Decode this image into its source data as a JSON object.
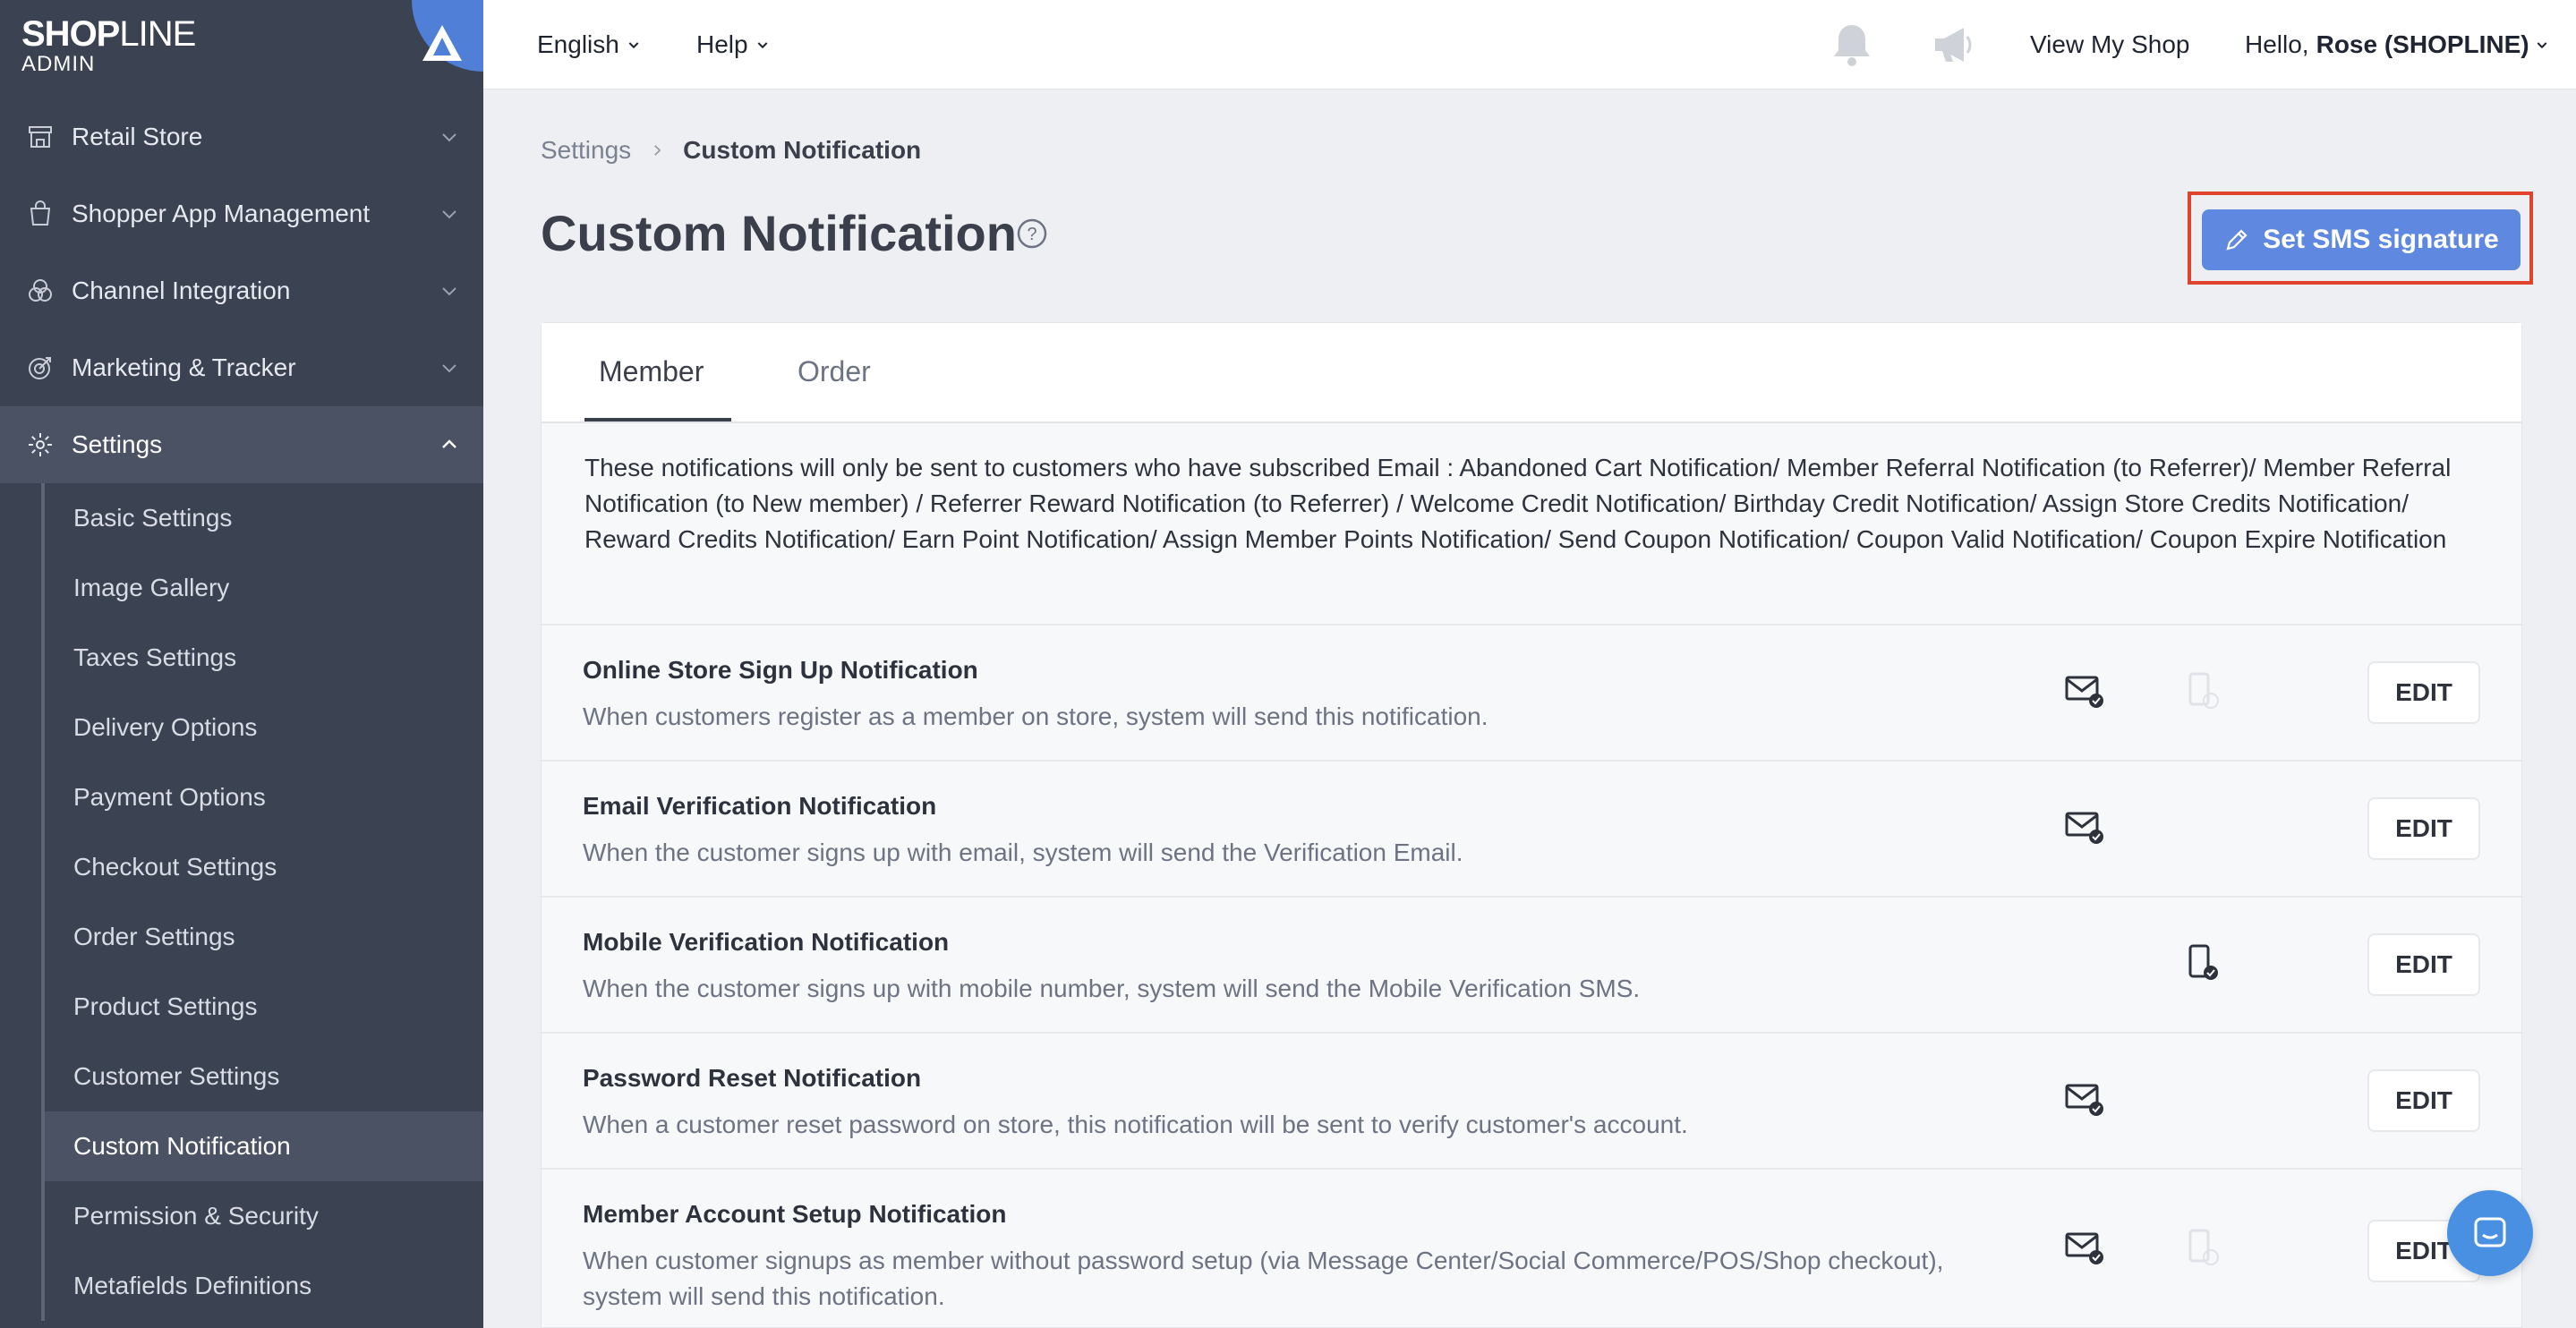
{
  "brand": {
    "logo_bold": "SHOP",
    "logo_light": "LINE",
    "logo_sub": "ADMIN"
  },
  "topbar": {
    "language": "English",
    "help": "Help",
    "view_shop": "View My Shop",
    "greeting_prefix": "Hello,",
    "user_name": "Rose (SHOPLINE)"
  },
  "sidebar": {
    "items": [
      {
        "label": "Retail Store",
        "icon": "store-icon"
      },
      {
        "label": "Shopper App Management",
        "icon": "shopping-bag-icon"
      },
      {
        "label": "Channel Integration",
        "icon": "channels-icon"
      },
      {
        "label": "Marketing & Tracker",
        "icon": "target-icon"
      },
      {
        "label": "Settings",
        "icon": "gear-icon"
      }
    ],
    "sub_items": [
      "Basic Settings",
      "Image Gallery",
      "Taxes Settings",
      "Delivery Options",
      "Payment Options",
      "Checkout Settings",
      "Order Settings",
      "Product Settings",
      "Customer Settings",
      "Custom Notification",
      "Permission & Security",
      "Metafields Definitions"
    ]
  },
  "breadcrumb": {
    "parent": "Settings",
    "current": "Custom Notification"
  },
  "page": {
    "title": "Custom Notification",
    "action_button": "Set SMS signature"
  },
  "tabs": [
    "Member",
    "Order"
  ],
  "notice": "These notifications will only be sent to customers who have subscribed Email : Abandoned Cart Notification/ Member Referral Notification (to Referrer)/ Member Referral Notification (to New member) / Referrer Reward Notification (to Referrer) / Welcome Credit Notification/ Birthday Credit Notification/ Assign Store Credits Notification/ Reward Credits Notification/ Earn Point Notification/ Assign Member Points Notification/ Send Coupon Notification/ Coupon Valid Notification/ Coupon Expire Notification",
  "notifications": [
    {
      "title": "Online Store Sign Up Notification",
      "desc": "When customers register as a member on store, system will send this notification.",
      "email": true,
      "sms": "disabled",
      "edit": "EDIT"
    },
    {
      "title": "Email Verification Notification",
      "desc": "When the customer signs up with email, system will send the Verification Email.",
      "email": true,
      "sms": "none",
      "edit": "EDIT"
    },
    {
      "title": "Mobile Verification Notification",
      "desc": "When the customer signs up with mobile number, system will send the Mobile Verification SMS.",
      "email": false,
      "sms": "enabled",
      "edit": "EDIT"
    },
    {
      "title": "Password Reset Notification",
      "desc": "When a customer reset password on store, this notification will be sent to verify customer's account.",
      "email": true,
      "sms": "none",
      "edit": "EDIT"
    },
    {
      "title": "Member Account Setup Notification",
      "desc": "When customer signups as member without password setup (via Message Center/Social Commerce/POS/Shop checkout), system will send this notification.",
      "email": true,
      "sms": "disabled",
      "edit": "EDIT"
    }
  ],
  "colors": {
    "sidebar_bg": "#3b4252",
    "primary": "#5f89e0",
    "highlight": "#e0432e",
    "chat": "#4a90e2"
  }
}
